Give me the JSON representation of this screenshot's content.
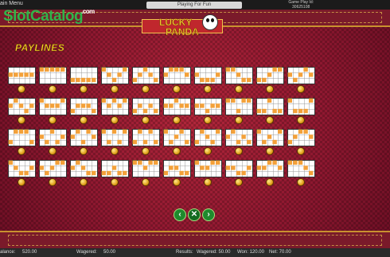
{
  "topbar": {
    "menu_label": "ain Menu",
    "mode": "Playing For Fun",
    "game_play_id_label": "Game Play Id:",
    "game_play_id": "30625108"
  },
  "brand": {
    "name_a": "Slot",
    "name_b": "Catalog",
    "suffix": ".com"
  },
  "logo": {
    "line1": "LUCKY",
    "line2": "PANDA"
  },
  "title": "PAYLINES",
  "paylines_count": 40,
  "status": {
    "balance_label": "alance:",
    "balance": "520.00",
    "wagered_label": "Wagered:",
    "wagered": "50.00",
    "results": "Results:",
    "wagered2": "Wagered: 50.00",
    "won": "Won: 120.00",
    "net": "Net: 70.00"
  },
  "colors": {
    "background": "#9b1c33",
    "accent": "#f7d92a",
    "line": "#f3a13a",
    "nav": "#1f8a2d"
  }
}
